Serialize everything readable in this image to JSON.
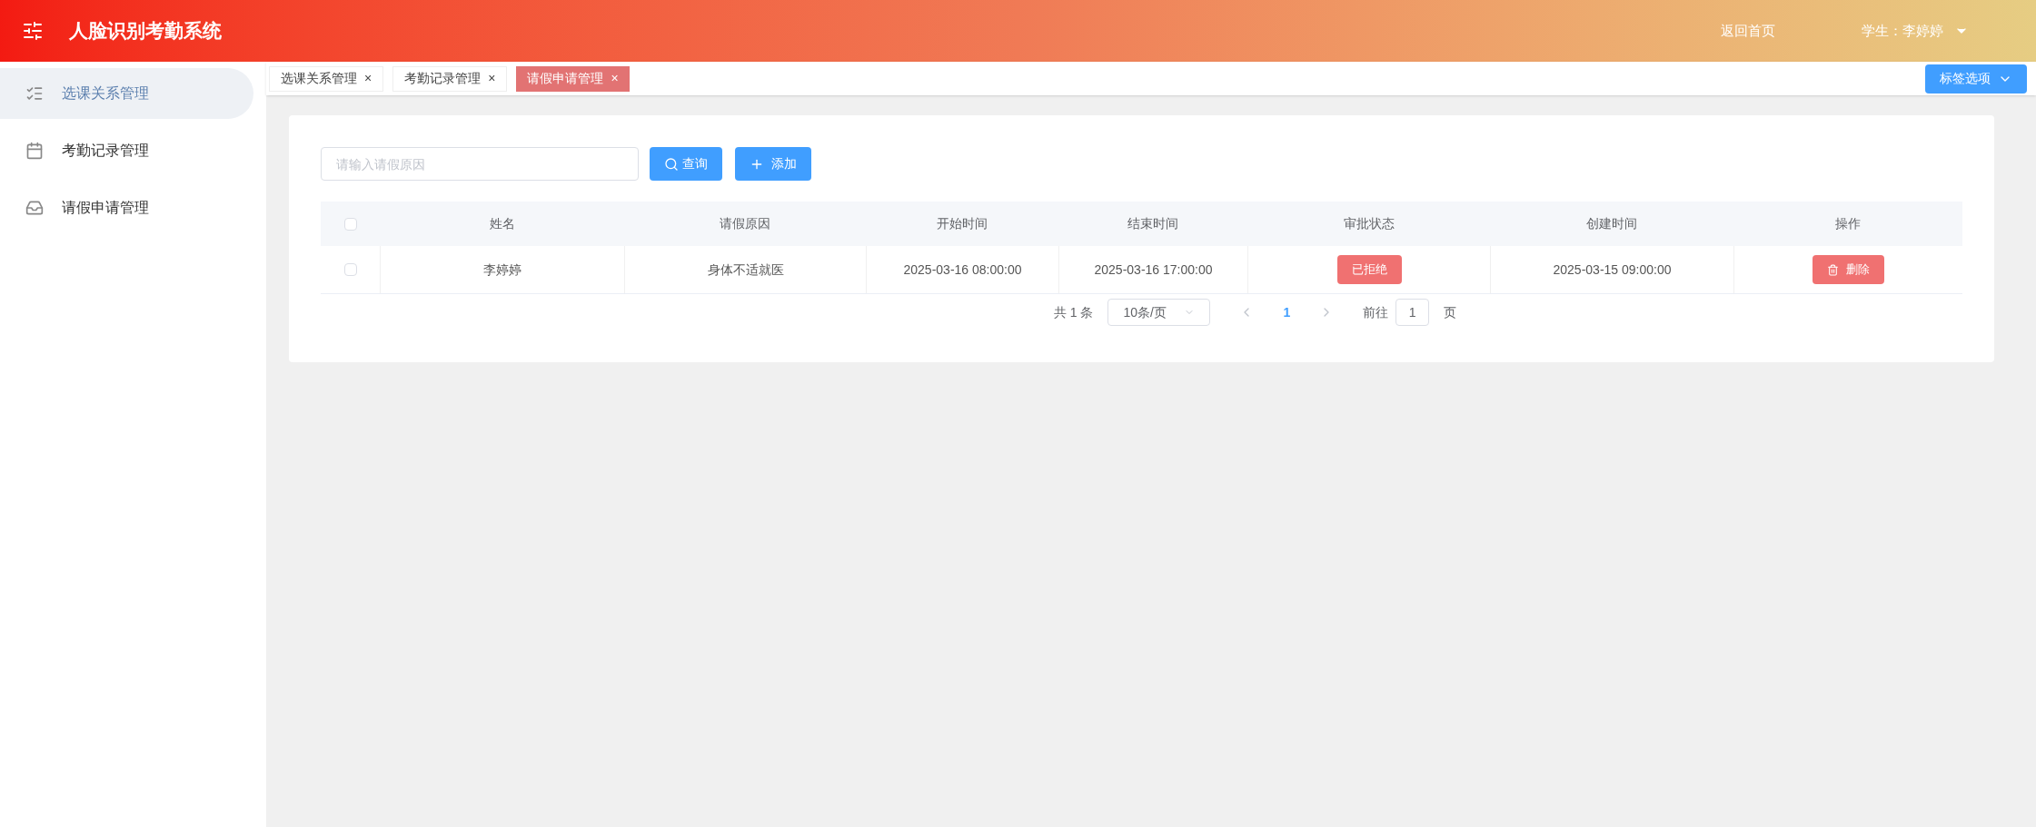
{
  "header": {
    "title": "人脸识别考勤系统",
    "home_link": "返回首页",
    "user": "学生：李婷婷"
  },
  "sidebar": {
    "items": [
      {
        "label": "选课关系管理",
        "selected": true
      },
      {
        "label": "考勤记录管理",
        "selected": false
      },
      {
        "label": "请假申请管理",
        "selected": false
      }
    ]
  },
  "tabs": [
    {
      "label": "选课关系管理",
      "close": "×",
      "selected": false
    },
    {
      "label": "考勤记录管理",
      "close": "×",
      "selected": false
    },
    {
      "label": "请假申请管理",
      "close": "×",
      "selected": true
    }
  ],
  "tab_options": "标签选项",
  "search": {
    "placeholder": "请输入请假原因"
  },
  "buttons": {
    "query": "查询",
    "add": "添加"
  },
  "table": {
    "all_checked": false,
    "columns": [
      "姓名",
      "请假原因",
      "开始时间",
      "结束时间",
      "审批状态",
      "创建时间",
      "操作"
    ],
    "rows": [
      {
        "checked": false,
        "name": "李婷婷",
        "reason": "身体不适就医",
        "start": "2025-03-16 08:00:00",
        "end": "2025-03-16 17:00:00",
        "status": {
          "label": "已拒绝",
          "kind": "rejected"
        },
        "created": "2025-03-15 09:00:00",
        "action": "删除"
      }
    ]
  },
  "pagination": {
    "total": "共 1 条",
    "page_size": "10条/页",
    "pages": [
      {
        "label": "1",
        "selected": true
      }
    ],
    "goto_label": "前往",
    "goto_value": "1",
    "goto_suffix": "页"
  }
}
